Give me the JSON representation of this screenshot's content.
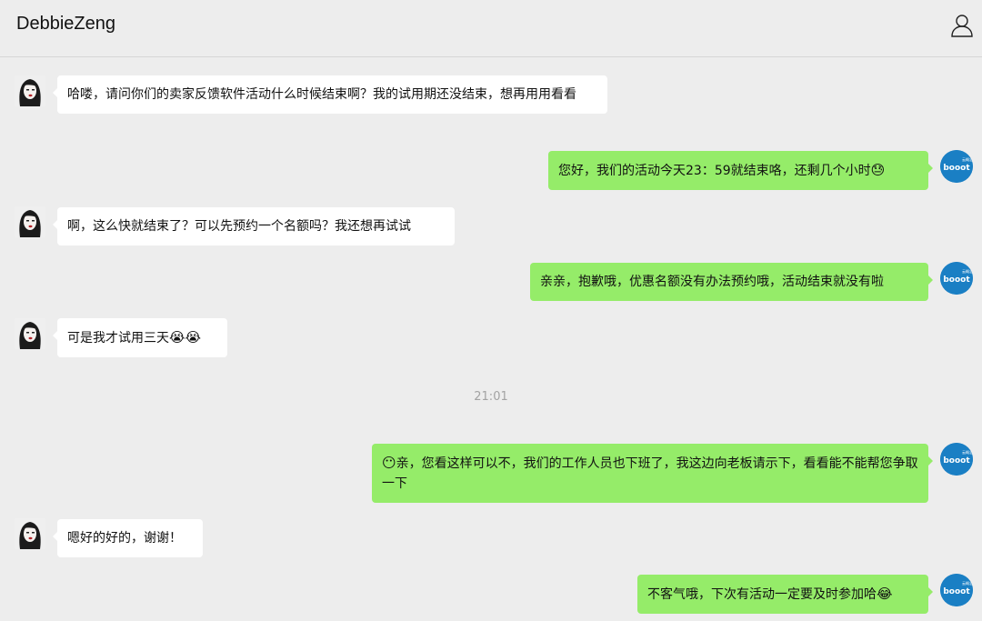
{
  "header": {
    "title": "DebbieZeng",
    "profile_icon": "person-outline-icon"
  },
  "avatars": {
    "left_icon": "girl-portrait-avatar",
    "right_icon": "booot-brand-avatar",
    "right_brand_text": "booot",
    "right_small_text": "云概念"
  },
  "messages": [
    {
      "side": "in",
      "text": "哈喽，请问你们的卖家反馈软件活动什么时候结束啊？我的试用期还没结束，想再用用看看"
    },
    {
      "side": "out",
      "text": "您好，我们的活动今天23：59就结束咯，还剩几个小时",
      "emoji_after": "😓"
    },
    {
      "side": "in",
      "text": "啊，这么快就结束了？可以先预约一个名额吗？我还想再试试"
    },
    {
      "side": "out",
      "text": "亲亲，抱歉哦，优惠名额没有办法预约哦，活动结束就没有啦"
    },
    {
      "side": "in",
      "text": "可是我才试用三天",
      "emoji_after": "😭😭"
    },
    {
      "side": "out",
      "emoji_before": "😶",
      "text": "亲，您看这样可以不，我们的工作人员也下班了，我这边向老板请示下，看看能不能帮您争取一下"
    },
    {
      "side": "in",
      "text": "嗯好的好的，谢谢！"
    },
    {
      "side": "out",
      "text": "不客气哦，下次有活动一定要及时参加哈",
      "emoji_after": "😂"
    }
  ],
  "timestamp": "21:01",
  "colors": {
    "background": "#ededed",
    "bubble_in": "#ffffff",
    "bubble_out": "#95ec69",
    "avatar_brand": "#1a7fc4"
  }
}
